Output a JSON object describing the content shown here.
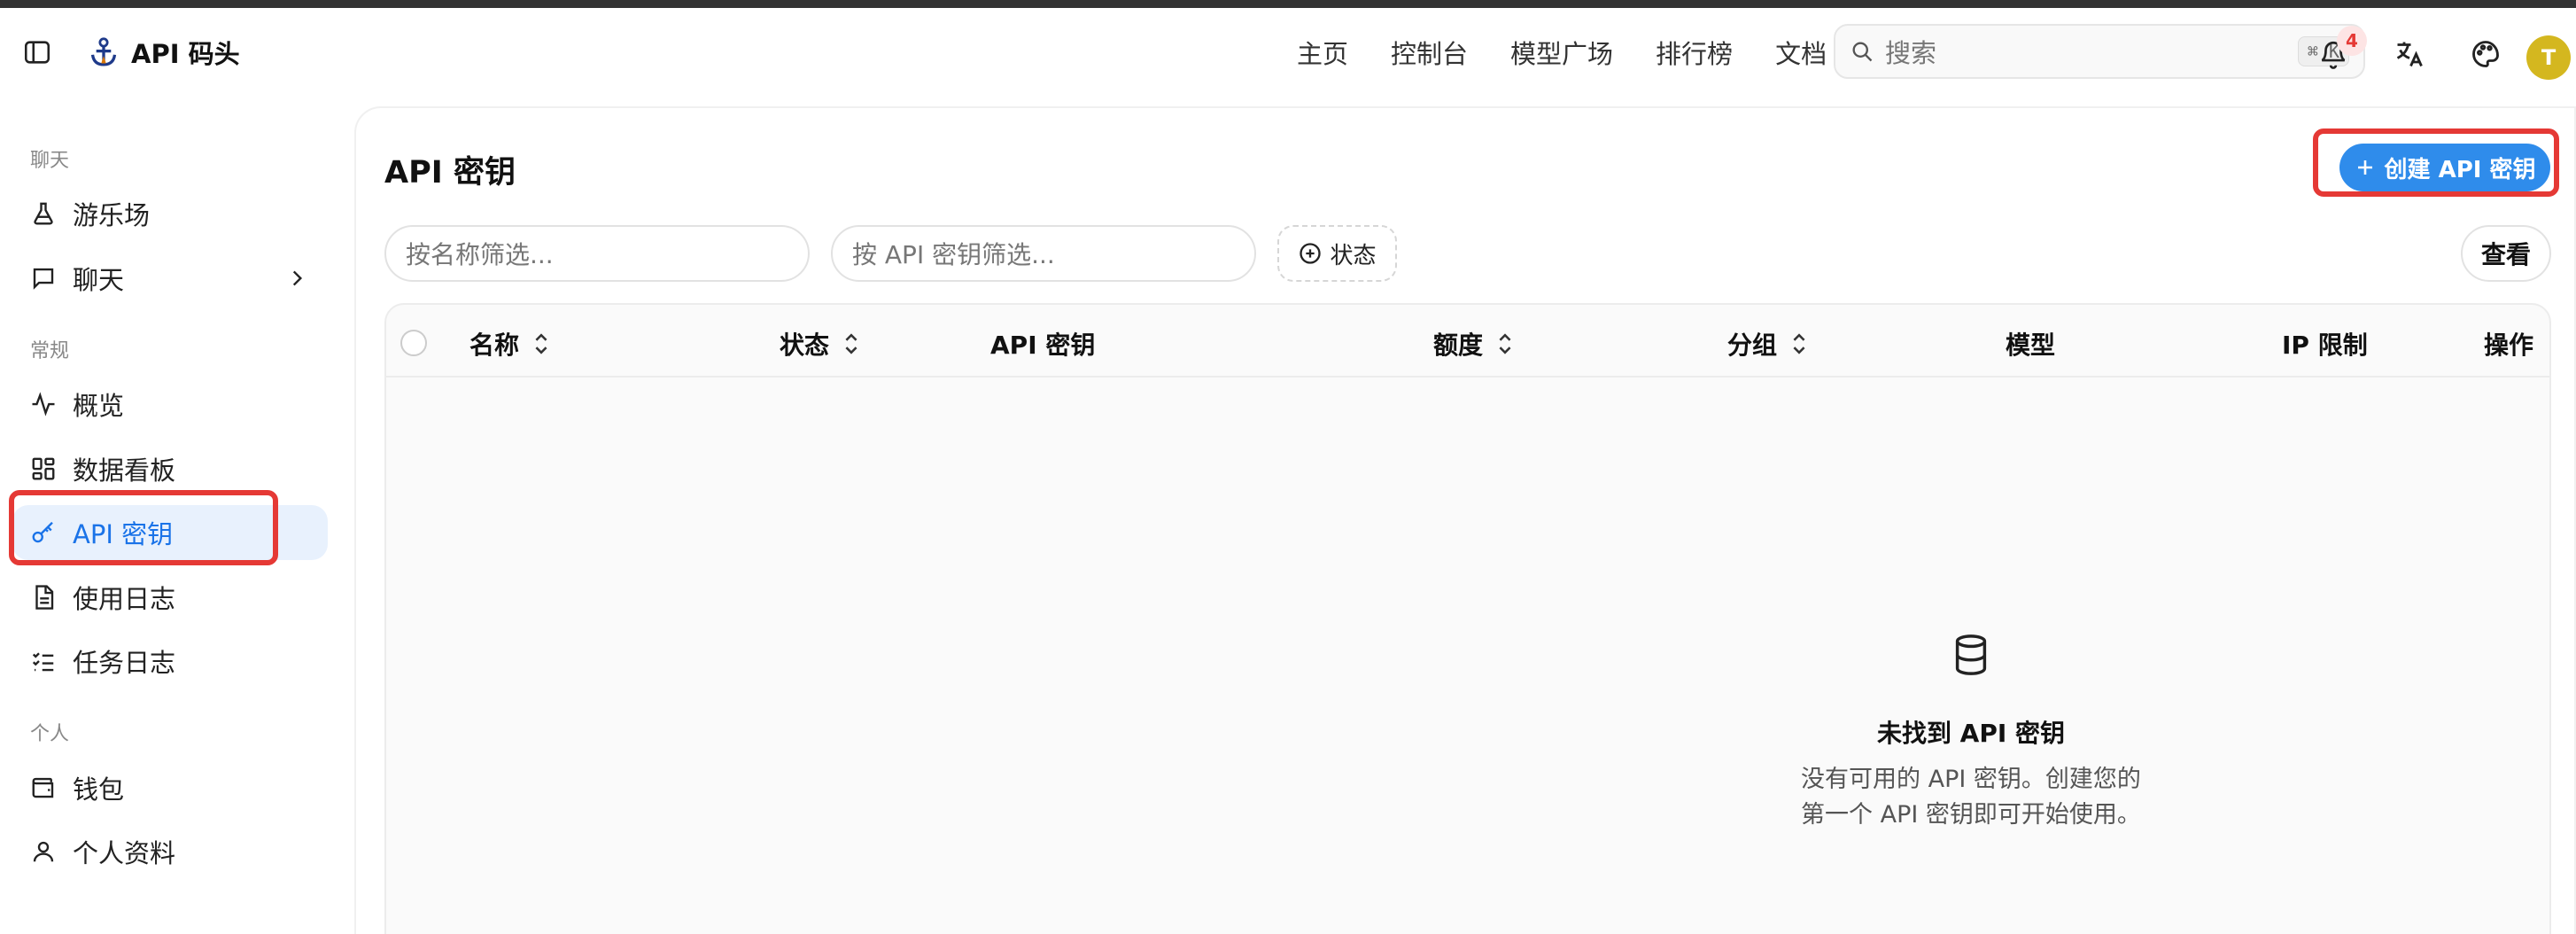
{
  "brand": {
    "name": "API 码头"
  },
  "nav": [
    {
      "label": "主页"
    },
    {
      "label": "控制台"
    },
    {
      "label": "模型广场"
    },
    {
      "label": "排行榜"
    },
    {
      "label": "文档"
    }
  ],
  "search": {
    "placeholder": "搜索",
    "shortcut": "⌘ K"
  },
  "notifications": {
    "count": "4"
  },
  "user": {
    "initial": "T"
  },
  "sidebar": {
    "sections": [
      {
        "label": "聊天"
      },
      {
        "label": "常规"
      },
      {
        "label": "个人"
      }
    ],
    "items": [
      {
        "label": "游乐场"
      },
      {
        "label": "聊天"
      },
      {
        "label": "概览"
      },
      {
        "label": "数据看板"
      },
      {
        "label": "API 密钥"
      },
      {
        "label": "使用日志"
      },
      {
        "label": "任务日志"
      },
      {
        "label": "钱包"
      },
      {
        "label": "个人资料"
      }
    ]
  },
  "main": {
    "title": "API 密钥",
    "create_label": "创建 API 密钥",
    "filters": {
      "name_placeholder": "按名称筛选...",
      "key_placeholder": "按 API 密钥筛选...",
      "status_label": "状态",
      "view_label": "查看"
    },
    "columns": [
      {
        "label": "名称"
      },
      {
        "label": "状态"
      },
      {
        "label": "API 密钥"
      },
      {
        "label": "额度"
      },
      {
        "label": "分组"
      },
      {
        "label": "模型"
      },
      {
        "label": "IP 限制"
      },
      {
        "label": "操作"
      }
    ],
    "empty": {
      "title": "未找到 API 密钥",
      "line1": "没有可用的 API 密钥。创建您的",
      "line2": "第一个 API 密钥即可开始使用。"
    }
  },
  "colors": {
    "accent": "#2f8ceb",
    "highlight": "#e53935",
    "active_bg": "#e8f1fd"
  }
}
